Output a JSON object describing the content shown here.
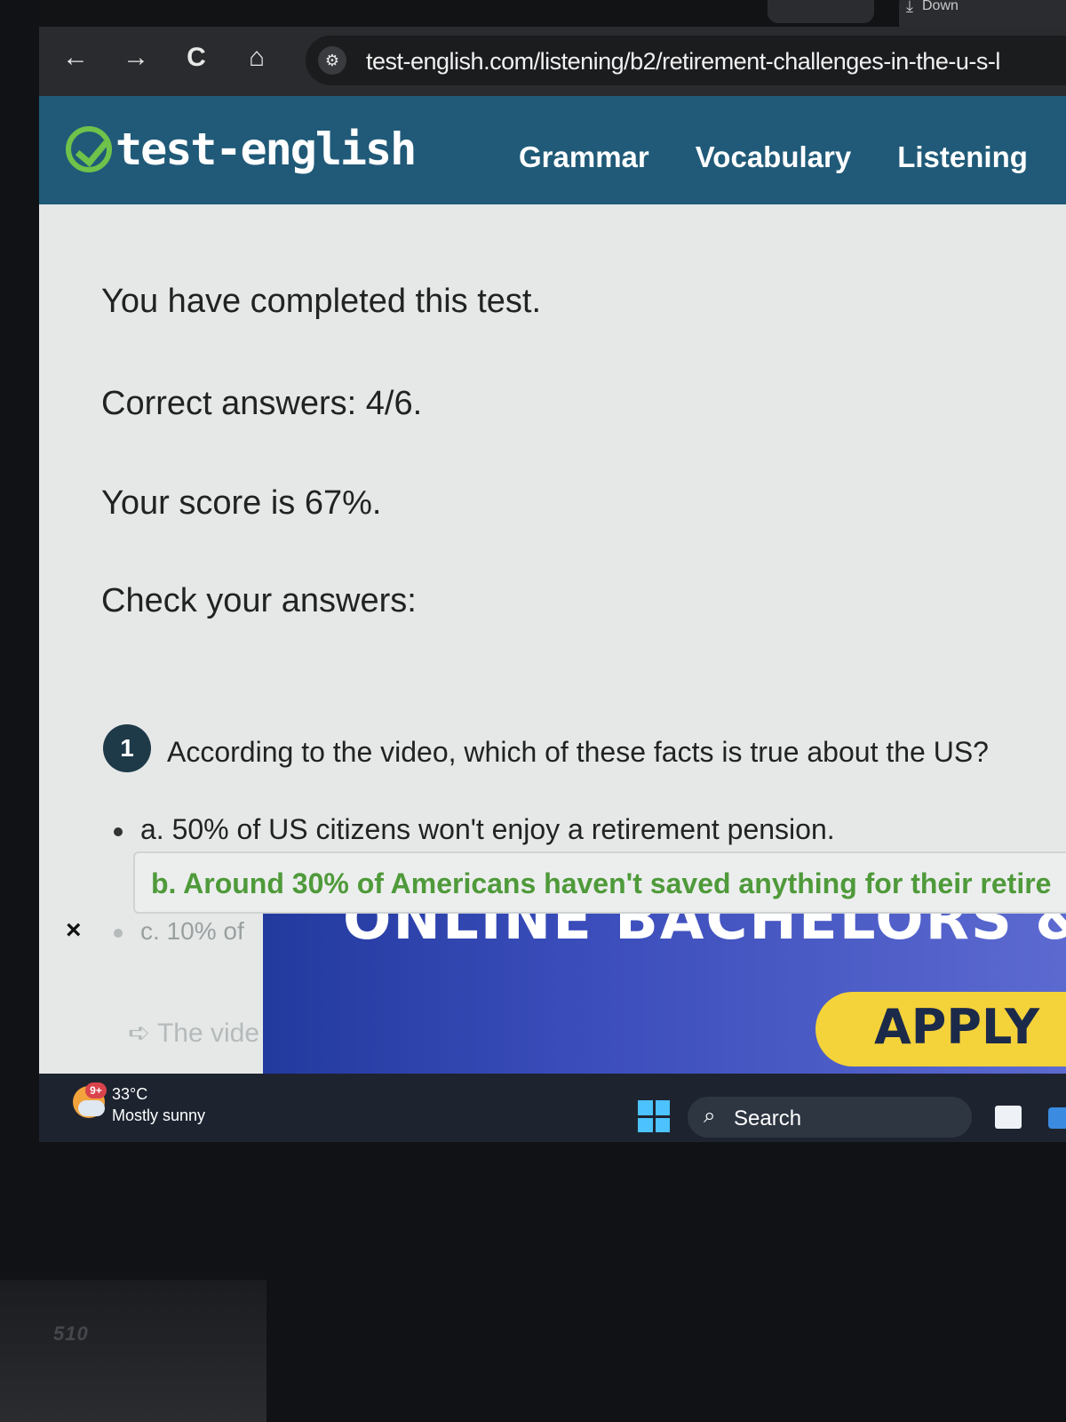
{
  "browser": {
    "download_chip_label": "Down",
    "url": "test-english.com/listening/b2/retirement-challenges-in-the-u-s-l",
    "nav": {
      "back": "←",
      "forward": "→",
      "reload": "C",
      "home": "⌂"
    }
  },
  "site": {
    "logo_text": "test-english",
    "nav": [
      "Grammar",
      "Vocabulary",
      "Listening"
    ]
  },
  "results": {
    "completed": "You have completed this test.",
    "correct": "Correct answers: 4/6.",
    "score": "Your score is 67%.",
    "check": "Check your answers:"
  },
  "question": {
    "number": "1",
    "text": "According to the video, which of these facts is true about the US?",
    "option_a": "a. 50% of US citizens won't enjoy a retirement pension.",
    "option_b": "b. Around 30% of Americans haven't saved anything for their retire",
    "option_c": "c. 10% of",
    "wrong_mark": "×",
    "note": "The vide"
  },
  "ad": {
    "headline": "ONLINE BACHELORS &",
    "cta": "APPLY"
  },
  "taskbar": {
    "weather_badge": "9+",
    "temperature": "33°C",
    "condition": "Mostly sunny",
    "search_label": "Search"
  },
  "bezel": {
    "label": "510"
  },
  "colors": {
    "header_bg": "#205a78",
    "logo_green": "#6fc24a",
    "correct_green": "#4f9a3a",
    "ad_yellow": "#f4d23a"
  }
}
